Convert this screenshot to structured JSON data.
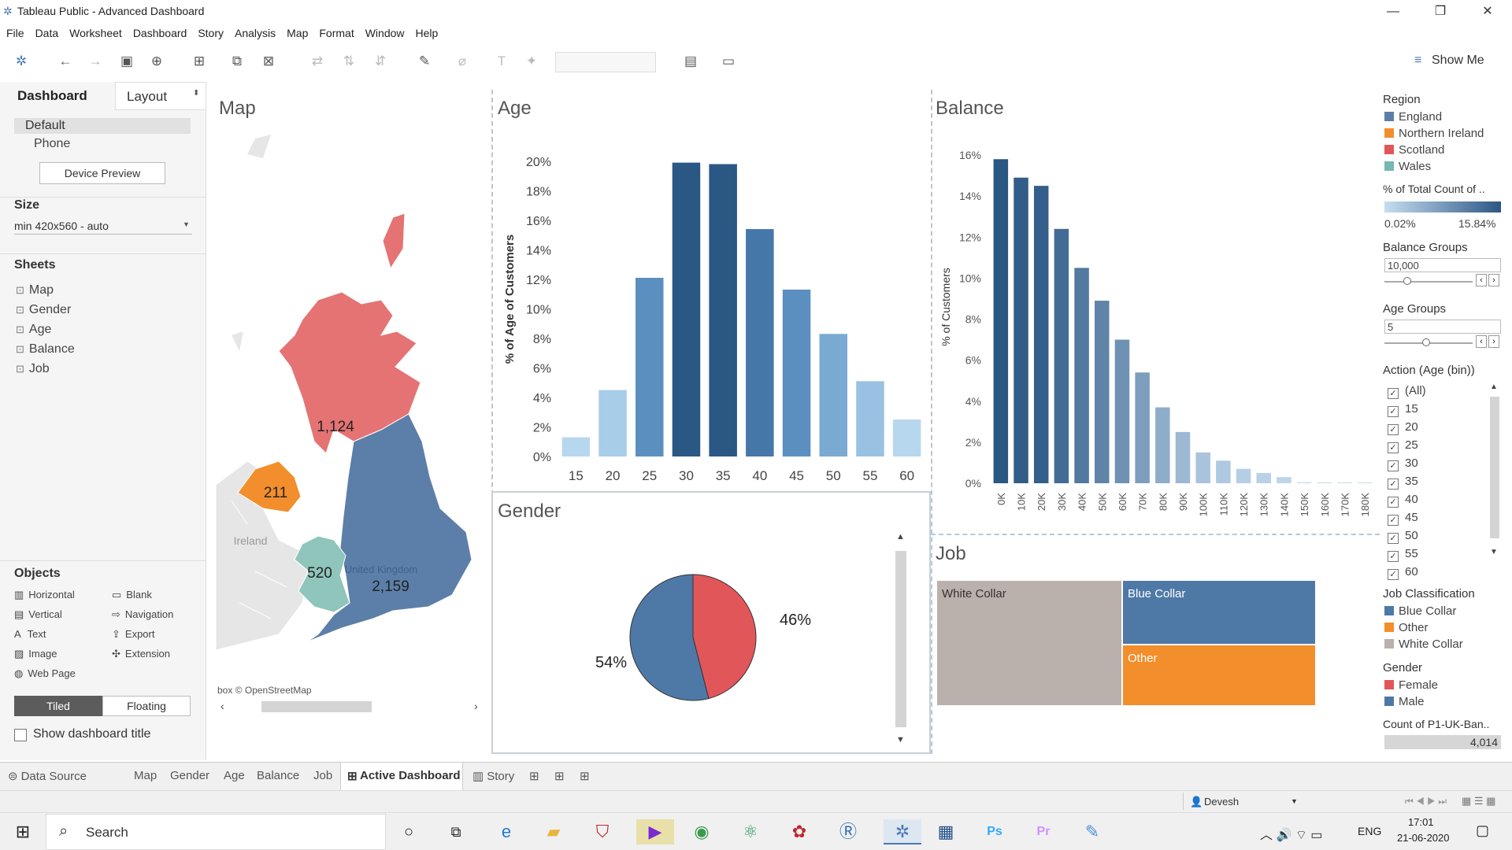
{
  "window": {
    "title": "Tableau Public - Advanced Dashboard",
    "minimize": "—",
    "maximize": "❐",
    "close": "✕"
  },
  "menu": [
    "File",
    "Data",
    "Worksheet",
    "Dashboard",
    "Story",
    "Analysis",
    "Map",
    "Format",
    "Window",
    "Help"
  ],
  "toolbar": {
    "show_me": "Show Me"
  },
  "left_panel": {
    "tab_dashboard": "Dashboard",
    "tab_layout": "Layout",
    "device_default": "Default",
    "device_phone": "Phone",
    "device_preview": "Device Preview",
    "size_heading": "Size",
    "size_value": "min 420x560 - auto",
    "sheets_heading": "Sheets",
    "sheets": [
      "Map",
      "Gender",
      "Age",
      "Balance",
      "Job"
    ],
    "objects_heading": "Objects",
    "objects_left": [
      "Horizontal",
      "Vertical",
      "Text",
      "Image",
      "Web Page"
    ],
    "objects_right": [
      "Blank",
      "Navigation",
      "Export",
      "Extension"
    ],
    "tiled": "Tiled",
    "floating": "Floating",
    "show_title": "Show dashboard title"
  },
  "map": {
    "title": "Map",
    "labels": {
      "scotland": "1,124",
      "ni": "211",
      "wales": "520",
      "england": "2,159",
      "ireland": "Ireland",
      "uk": "United Kingdom"
    },
    "attribution": "box © OpenStreetMap"
  },
  "age": {
    "title": "Age",
    "ylabel": "% of Age of Customers",
    "yticks": [
      "20%",
      "18%",
      "16%",
      "14%",
      "12%",
      "10%",
      "8%",
      "6%",
      "4%",
      "2%",
      "0%"
    ]
  },
  "gender": {
    "title": "Gender",
    "female_label": "46%",
    "male_label": "54%"
  },
  "balance": {
    "title": "Balance",
    "ylabel": "% of Customers",
    "yticks": [
      "16%",
      "14%",
      "12%",
      "10%",
      "8%",
      "6%",
      "4%",
      "2%",
      "0%"
    ]
  },
  "job": {
    "title": "Job",
    "white": "White Collar",
    "blue": "Blue Collar",
    "other": "Other"
  },
  "legends": {
    "region_heading": "Region",
    "regions": [
      {
        "name": "England",
        "color": "#5b7fa8"
      },
      {
        "name": "Northern Ireland",
        "color": "#f28e2b"
      },
      {
        "name": "Scotland",
        "color": "#e15759"
      },
      {
        "name": "Wales",
        "color": "#76b7b2"
      }
    ],
    "pct_heading": "% of Total Count of ..",
    "pct_min": "0.02%",
    "pct_max": "15.84%",
    "balance_groups_heading": "Balance Groups",
    "balance_groups_value": "10,000",
    "age_groups_heading": "Age Groups",
    "age_groups_value": "5",
    "action_heading": "Action (Age (bin))",
    "action_items": [
      "(All)",
      "15",
      "20",
      "25",
      "30",
      "35",
      "40",
      "45",
      "50",
      "55",
      "60"
    ],
    "job_heading": "Job Classification",
    "jobs": [
      {
        "name": "Blue Collar",
        "color": "#4e79a7"
      },
      {
        "name": "Other",
        "color": "#f28e2b"
      },
      {
        "name": "White Collar",
        "color": "#bab0ac"
      }
    ],
    "gender_heading": "Gender",
    "genders": [
      {
        "name": "Female",
        "color": "#e15759"
      },
      {
        "name": "Male",
        "color": "#4e79a7"
      }
    ],
    "count_heading": "Count of P1-UK-Ban..",
    "count_value": "4,014"
  },
  "tabs": {
    "data_source": "Data Source",
    "sheets": [
      "Map",
      "Gender",
      "Age",
      "Balance",
      "Job"
    ],
    "active": "Active Dashboard",
    "story": "Story"
  },
  "status": {
    "user": "Devesh"
  },
  "taskbar": {
    "search": "Search",
    "lang": "ENG",
    "time": "17:01",
    "date": "21-06-2020"
  },
  "chart_data": [
    {
      "type": "bar",
      "title": "Age",
      "ylabel": "% of Age of Customers",
      "categories": [
        "15",
        "20",
        "25",
        "30",
        "35",
        "40",
        "45",
        "50",
        "55",
        "60"
      ],
      "values": [
        1.3,
        4.5,
        12.1,
        19.9,
        19.8,
        15.4,
        11.3,
        8.3,
        5.1,
        2.5
      ],
      "ylim": [
        0,
        21
      ],
      "colors": [
        "#b7d7ee",
        "#a8cde8",
        "#5b8fbf",
        "#2b5784",
        "#2b5784",
        "#4677a9",
        "#5b8fbf",
        "#7aaad2",
        "#99c2e2",
        "#b7d7ee"
      ]
    },
    {
      "type": "bar",
      "title": "Balance",
      "ylabel": "% of Customers",
      "categories": [
        "0K",
        "10K",
        "20K",
        "30K",
        "40K",
        "50K",
        "60K",
        "70K",
        "80K",
        "90K",
        "100K",
        "110K",
        "120K",
        "130K",
        "140K",
        "150K",
        "160K",
        "170K",
        "180K"
      ],
      "values": [
        15.8,
        14.9,
        14.5,
        12.4,
        10.5,
        8.9,
        7.0,
        5.4,
        3.7,
        2.5,
        1.5,
        1.1,
        0.7,
        0.5,
        0.3,
        0.05,
        0.04,
        0.03,
        0.02
      ],
      "ylim": [
        0,
        16.5
      ]
    },
    {
      "type": "pie",
      "title": "Gender",
      "labels": [
        "Female",
        "Male"
      ],
      "values": [
        46,
        54
      ],
      "colors": [
        "#e15759",
        "#4e79a7"
      ]
    }
  ]
}
